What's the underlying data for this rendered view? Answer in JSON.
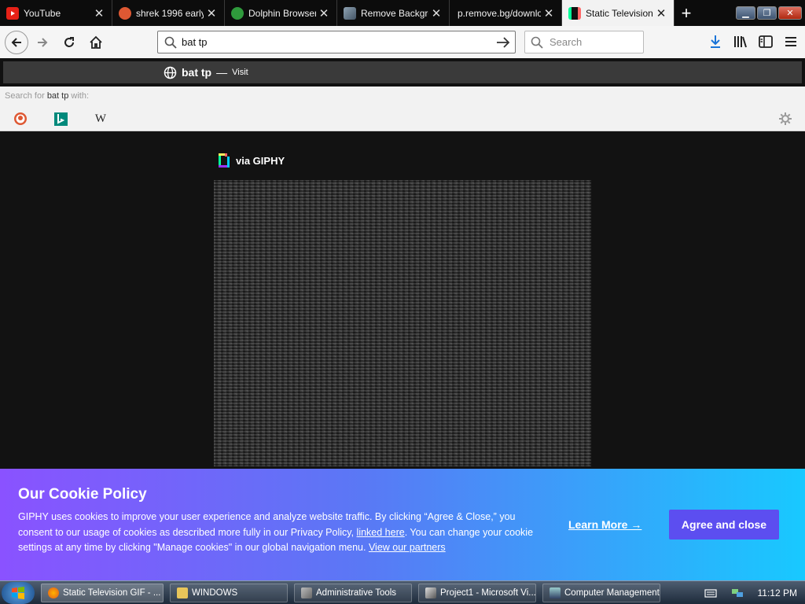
{
  "tabs": [
    {
      "label": "YouTube",
      "icon": "youtube-icon",
      "color": "#e62117"
    },
    {
      "label": "shrek 1996 early",
      "icon": "duckduckgo-icon",
      "color": "#de5833"
    },
    {
      "label": "Dolphin Browser /",
      "icon": "dolphin-icon",
      "color": "#2f9a3c"
    },
    {
      "label": "Remove Backgrou",
      "icon": "layers-icon",
      "color": "#6a7f8f"
    },
    {
      "label": "p.remove.bg/downlo",
      "icon": "",
      "color": ""
    },
    {
      "label": "Static Television G",
      "icon": "giphy-icon",
      "color": "#111111"
    }
  ],
  "toolbar": {
    "url": "bat tp",
    "search_placeholder": "Search"
  },
  "suggestion": {
    "text": "bat tp",
    "dash": "—",
    "action": "Visit"
  },
  "search_with": {
    "prefix": "Search for",
    "term": "bat tp",
    "suffix": "with:",
    "engines": [
      "duckduckgo",
      "bing",
      "wikipedia"
    ],
    "wiki_glyph": "W"
  },
  "page": {
    "via": "via GIPHY"
  },
  "cookie": {
    "title": "Our Cookie Policy",
    "body_part1": "GIPHY uses cookies to improve your user experience and analyze website traffic. By clicking “Agree & Close,” you consent to our usage of cookies as described more fully in our Privacy Policy,",
    "link1": "linked here",
    "body_part2": ". You can change your cookie settings at any time by clicking \"Manage cookies\" in our global navigation menu.",
    "link2": "View our partners",
    "learn_more": "Learn More →",
    "agree": "Agree and close",
    "agree_color": "#5c4ef0"
  },
  "taskbar": {
    "tasks": [
      {
        "label": "Static Television GIF - ...",
        "icon": "firefox-icon"
      },
      {
        "label": "WINDOWS",
        "icon": "folder-icon"
      },
      {
        "label": "Administrative Tools",
        "icon": "admin-tools-icon"
      },
      {
        "label": "Project1 - Microsoft Vi...",
        "icon": "vb-icon"
      },
      {
        "label": "Computer Management",
        "icon": "computer-icon"
      }
    ],
    "time": "11:12 PM"
  }
}
